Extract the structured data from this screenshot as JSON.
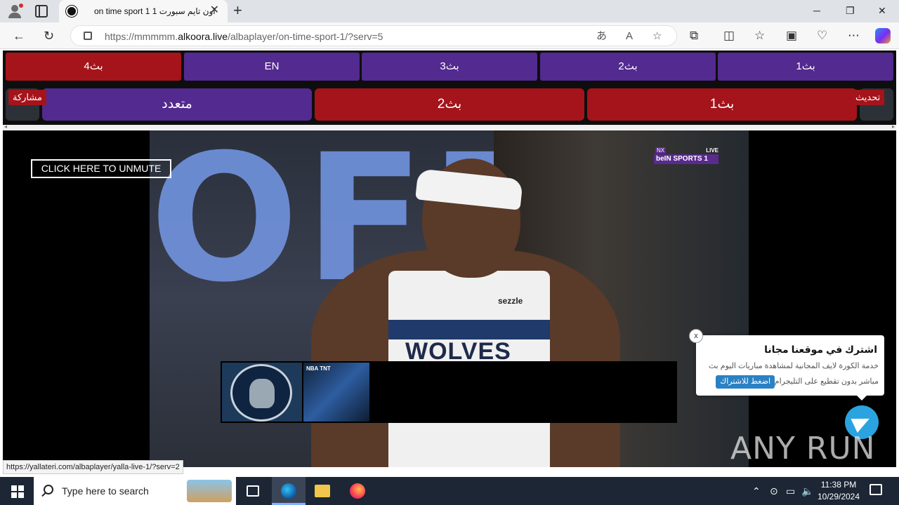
{
  "browser": {
    "tab_title": "on time sport 1 اون تايم سبورت 1",
    "url_prefix": "https://mmmmm.",
    "url_host": "alkoora.live",
    "url_path": "/albaplayer/on-time-sport-1/?serv=5",
    "icons": {
      "profile": "profile-icon",
      "tab_actions": "tab-actions-icon",
      "back": "←",
      "refresh": "↻",
      "read_aloud": "read-aloud-icon",
      "favorite": "☆",
      "extensions": "extensions-icon",
      "split": "split-screen-icon",
      "favorites": "favorites-icon",
      "collections": "collections-icon",
      "more": "⋯"
    }
  },
  "servers": {
    "row1": [
      {
        "label": "بث4",
        "color": "#a5141b"
      },
      {
        "label": "EN",
        "color": "#532a8f"
      },
      {
        "label": "بث3",
        "color": "#532a8f"
      },
      {
        "label": "بث2",
        "color": "#532a8f"
      },
      {
        "label": "بث1",
        "color": "#532a8f"
      }
    ],
    "row2": [
      {
        "label": "متعدد",
        "color": "#532a8f"
      },
      {
        "label": "بث2",
        "color": "#a5141b"
      },
      {
        "label": "بث1",
        "color": "#a5141b"
      }
    ],
    "share_label": "مشاركة",
    "refresh_label": "تحديث"
  },
  "player": {
    "unmute_label": "CLICK HERE TO UNMUTE",
    "channel_logo_top": "NX",
    "channel_logo_live": "LIVE",
    "channel_logo_main": "beIN SPORTS 1",
    "bg_text": "OFF",
    "jersey_text": "WOLVES",
    "jersey_sponsor": "sezzle",
    "scorebar_label": "NBA TNT"
  },
  "subscribe_popup": {
    "title": "اشترك في موقعنا مجانا",
    "desc_line1": "خدمة الكورة لايف المجانية لمشاهدة مباريات اليوم بث",
    "desc_line2": "مباشر بدون تقطيع على التليجرام",
    "button_label": "اضغط للاشتراك",
    "close_label": "x"
  },
  "watermark": "ANY RUN",
  "status_url": "https://yallateri.com/albaplayer/yalla-live-1/?serv=2",
  "taskbar": {
    "search_placeholder": "Type here to search",
    "time": "11:38 PM",
    "date": "10/29/2024"
  }
}
